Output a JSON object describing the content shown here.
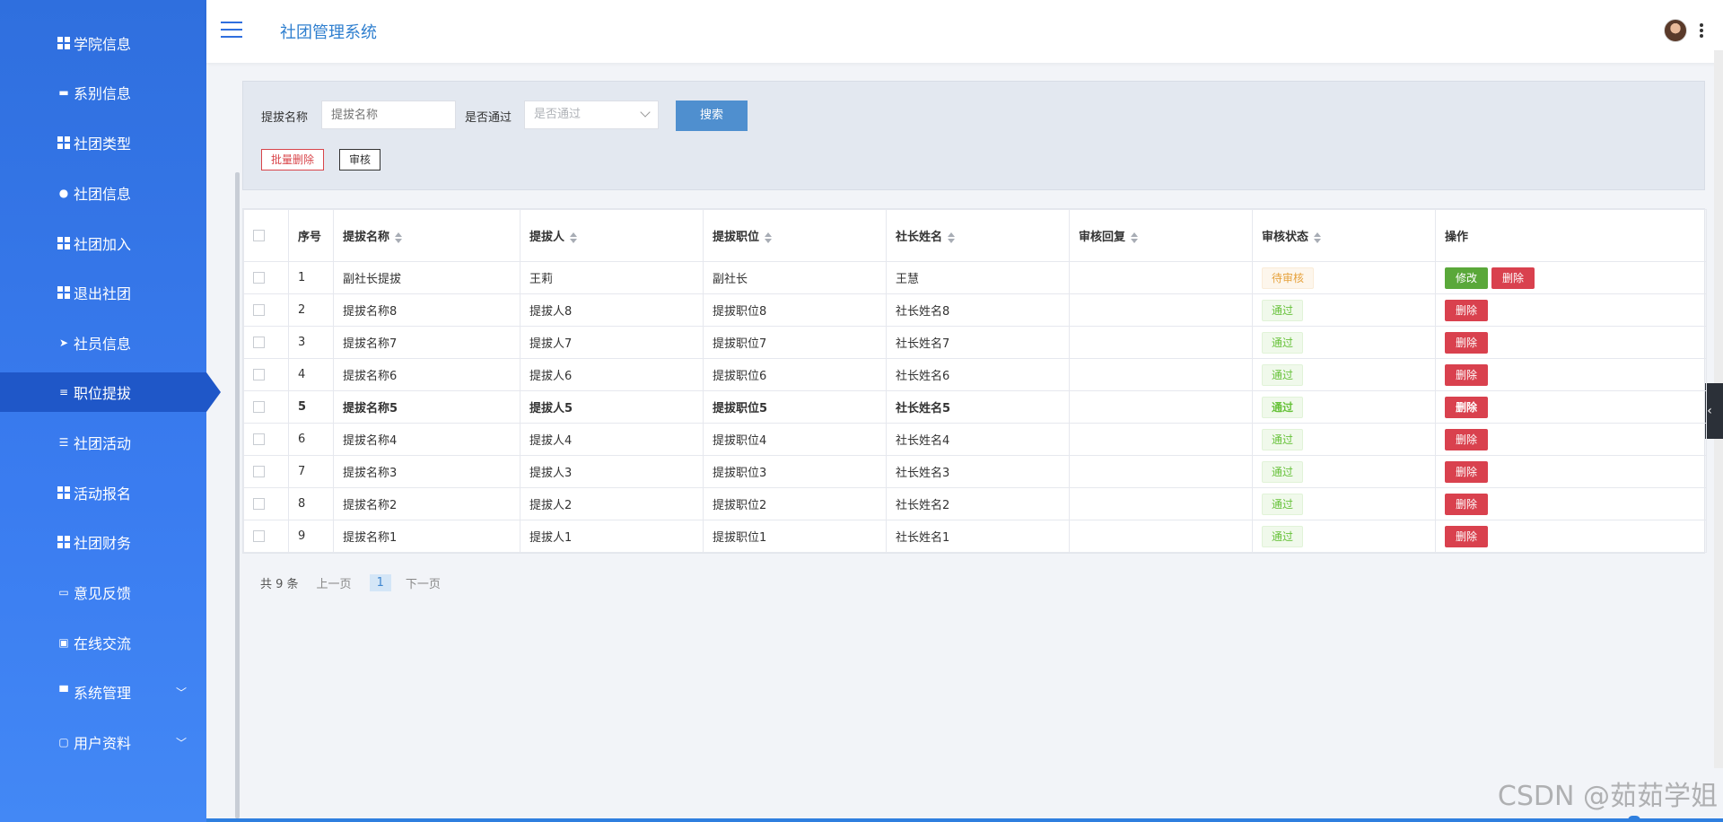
{
  "app": {
    "title": "社团管理系统"
  },
  "sidebar": {
    "items": [
      {
        "label": "学院信息",
        "icon": "grid-icon"
      },
      {
        "label": "系别信息",
        "icon": "briefcase-icon"
      },
      {
        "label": "社团类型",
        "icon": "grid-icon"
      },
      {
        "label": "社团信息",
        "icon": "location-pin-icon"
      },
      {
        "label": "社团加入",
        "icon": "grid-icon"
      },
      {
        "label": "退出社团",
        "icon": "grid-icon"
      },
      {
        "label": "社员信息",
        "icon": "send-icon"
      },
      {
        "label": "职位提拔",
        "icon": "sliders-icon",
        "active": true
      },
      {
        "label": "社团活动",
        "icon": "list-icon"
      },
      {
        "label": "活动报名",
        "icon": "grid-icon"
      },
      {
        "label": "社团财务",
        "icon": "grid-icon"
      },
      {
        "label": "意见反馈",
        "icon": "ticket-icon"
      },
      {
        "label": "在线交流",
        "icon": "chart-icon"
      },
      {
        "label": "系统管理",
        "icon": "monitor-icon",
        "expandable": true
      },
      {
        "label": "用户资料",
        "icon": "calendar-icon",
        "expandable": true
      }
    ]
  },
  "search": {
    "name_label": "提拔名称",
    "name_placeholder": "提拔名称",
    "pass_label": "是否通过",
    "pass_placeholder": "是否通过",
    "search_button": "搜索",
    "batch_delete": "批量删除",
    "audit": "审核"
  },
  "table": {
    "headers": [
      "序号",
      "提拔名称",
      "提拔人",
      "提拔职位",
      "社长姓名",
      "审核回复",
      "审核状态",
      "操作"
    ],
    "rows": [
      {
        "no": "1",
        "name": "副社长提拔",
        "person": "王莉",
        "position": "副社长",
        "president": "王慧",
        "reply": "",
        "status": "待审核",
        "status_type": "pending",
        "edit": "修改",
        "delete": "删除"
      },
      {
        "no": "2",
        "name": "提拔名称8",
        "person": "提拔人8",
        "position": "提拔职位8",
        "president": "社长姓名8",
        "reply": "",
        "status": "通过",
        "status_type": "pass",
        "delete": "删除"
      },
      {
        "no": "3",
        "name": "提拔名称7",
        "person": "提拔人7",
        "position": "提拔职位7",
        "president": "社长姓名7",
        "reply": "",
        "status": "通过",
        "status_type": "pass",
        "delete": "删除"
      },
      {
        "no": "4",
        "name": "提拔名称6",
        "person": "提拔人6",
        "position": "提拔职位6",
        "president": "社长姓名6",
        "reply": "",
        "status": "通过",
        "status_type": "pass",
        "delete": "删除"
      },
      {
        "no": "5",
        "name": "提拔名称5",
        "person": "提拔人5",
        "position": "提拔职位5",
        "president": "社长姓名5",
        "reply": "",
        "status": "通过",
        "status_type": "pass",
        "delete": "删除",
        "bold": true
      },
      {
        "no": "6",
        "name": "提拔名称4",
        "person": "提拔人4",
        "position": "提拔职位4",
        "president": "社长姓名4",
        "reply": "",
        "status": "通过",
        "status_type": "pass",
        "delete": "删除"
      },
      {
        "no": "7",
        "name": "提拔名称3",
        "person": "提拔人3",
        "position": "提拔职位3",
        "president": "社长姓名3",
        "reply": "",
        "status": "通过",
        "status_type": "pass",
        "delete": "删除"
      },
      {
        "no": "8",
        "name": "提拔名称2",
        "person": "提拔人2",
        "position": "提拔职位2",
        "president": "社长姓名2",
        "reply": "",
        "status": "通过",
        "status_type": "pass",
        "delete": "删除"
      },
      {
        "no": "9",
        "name": "提拔名称1",
        "person": "提拔人1",
        "position": "提拔职位1",
        "president": "社长姓名1",
        "reply": "",
        "status": "通过",
        "status_type": "pass",
        "delete": "删除"
      }
    ]
  },
  "pagination": {
    "total": "共 9 条",
    "prev": "上一页",
    "current": "1",
    "next": "下一页"
  },
  "watermark": "CSDN @茹茹学姐",
  "colors": {
    "sidebar": "#2f6fde",
    "active": "#1f57c8",
    "pass": "#67c23a",
    "pending": "#e6a23c",
    "delete": "#d9414e",
    "edit": "#5aa83a"
  }
}
